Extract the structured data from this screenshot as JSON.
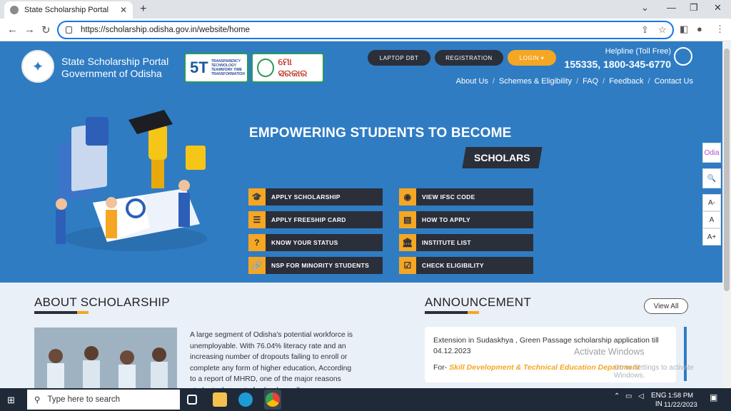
{
  "browser": {
    "tab_title": "State Scholarship Portal",
    "new_tab": "+",
    "url": "https://scholarship.odisha.gov.in/website/home",
    "controls": {
      "minimize": "⌄",
      "restore": "—",
      "maximize": "❐",
      "close": "✕"
    }
  },
  "header": {
    "portal_line1": "State Scholarship Portal",
    "portal_line2": "Government of Odisha",
    "badge_5t": "5T",
    "badge_5t_sub": "TRANSPARENCY TECHNOLOGY TEAMWORK TIME TRANSFORMATION",
    "badge_mo": "ମୋ ସରକାର",
    "buttons": [
      "LAPTOP DBT",
      "REGISTRATION",
      "LOGIN ▾"
    ],
    "helpline_label": "Helpline (Toll Free)",
    "helpline_number": "155335, 1800-345-6770",
    "menu": [
      "About Us",
      "Schemes & Eligibility",
      "FAQ",
      "Feedback",
      "Contact Us"
    ]
  },
  "hero": {
    "headline": "EMPOWERING STUDENTS TO BECOME",
    "highlight": "SCHOLARS",
    "actions_left": [
      {
        "label": "APPLY SCHOLARSHIP",
        "icon": "graduation-cap-icon",
        "glyph": "🎓"
      },
      {
        "label": "APPLY FREESHIP CARD",
        "icon": "list-icon",
        "glyph": "☰"
      },
      {
        "label": "KNOW YOUR STATUS",
        "icon": "question-icon",
        "glyph": "?"
      },
      {
        "label": "NSP FOR MINORITY STUDENTS",
        "icon": "link-icon",
        "glyph": "🔗"
      }
    ],
    "actions_right": [
      {
        "label": "VIEW IFSC CODE",
        "icon": "eye-icon",
        "glyph": "◉"
      },
      {
        "label": "HOW TO APPLY",
        "icon": "document-icon",
        "glyph": "▤"
      },
      {
        "label": "INSTITUTE LIST",
        "icon": "bank-icon",
        "glyph": "🏛"
      },
      {
        "label": "CHECK ELIGIBILITY",
        "icon": "checkbox-icon",
        "glyph": "☑"
      }
    ]
  },
  "about": {
    "title": "ABOUT SCHOLARSHIP",
    "text": "A large segment of Odisha's potential workforce is unemployable. With 76.04% literacy rate and an increasing number of dropouts failing to enroll or complete any form of higher education, According to a report of MHRD, one of the major reasons students drop out of school or colleges"
  },
  "announcement": {
    "title": "ANNOUNCEMENT",
    "view_all": "View All",
    "item_text": "Extension in Sudaskhya , Green Passage scholarship application till 04.12.2023",
    "for_label": "For-",
    "department": "Skill Development & Technical Education Department"
  },
  "watermark": {
    "line1": "Activate Windows",
    "line2": "Go to Settings to activate Windows."
  },
  "side_tools": [
    "Odia",
    "🔍",
    "A-",
    "A",
    "A+"
  ],
  "taskbar": {
    "search_placeholder": "Type here to search",
    "lang1": "ENG",
    "lang2": "IN",
    "time": "1:58 PM",
    "date": "11/22/2023"
  },
  "colors": {
    "primary_blue": "#2f7cc3",
    "accent_orange": "#f5a623",
    "dark": "#2b2f3a"
  }
}
